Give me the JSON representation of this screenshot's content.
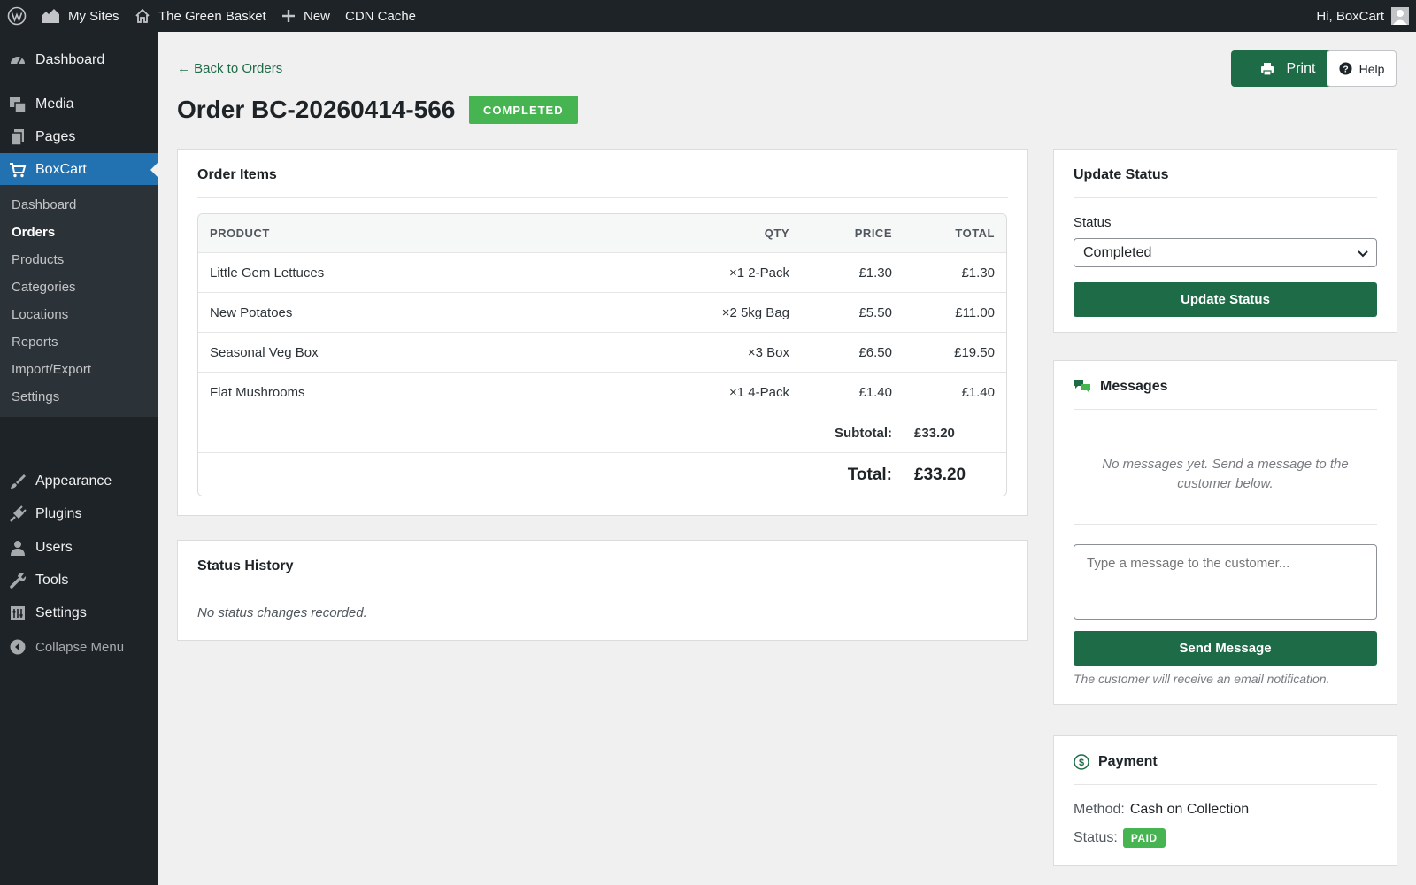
{
  "adminbar": {
    "my_sites": "My Sites",
    "site_name": "The Green Basket",
    "new_label": "New",
    "cdn_cache": "CDN Cache",
    "greeting": "Hi, BoxCart"
  },
  "sidebar": {
    "items": [
      {
        "label": "Dashboard",
        "icon": "dashboard-icon"
      },
      {
        "label": "Media",
        "icon": "media-icon"
      },
      {
        "label": "Pages",
        "icon": "pages-icon"
      },
      {
        "label": "BoxCart",
        "icon": "cart-icon",
        "current": true
      },
      {
        "label": "Appearance",
        "icon": "brush-icon"
      },
      {
        "label": "Plugins",
        "icon": "plugin-icon"
      },
      {
        "label": "Users",
        "icon": "user-icon"
      },
      {
        "label": "Tools",
        "icon": "wrench-icon"
      },
      {
        "label": "Settings",
        "icon": "settings-icon"
      },
      {
        "label": "Collapse Menu",
        "icon": "collapse-icon"
      }
    ],
    "submenu": [
      "Dashboard",
      "Orders",
      "Products",
      "Categories",
      "Locations",
      "Reports",
      "Import/Export",
      "Settings"
    ],
    "submenu_current": "Orders"
  },
  "header": {
    "back_link": "← Back to Orders",
    "title": "Order BC-20260414-566",
    "status_badge": "COMPLETED",
    "print_label": "Print",
    "help_label": "Help"
  },
  "order_items": {
    "title": "Order Items",
    "columns": {
      "product": "PRODUCT",
      "qty": "QTY",
      "price": "PRICE",
      "total": "TOTAL"
    },
    "rows": [
      {
        "product": "Little Gem Lettuces",
        "qty": "×1 2-Pack",
        "price": "£1.30",
        "total": "£1.30"
      },
      {
        "product": "New Potatoes",
        "qty": "×2 5kg Bag",
        "price": "£5.50",
        "total": "£11.00"
      },
      {
        "product": "Seasonal Veg Box",
        "qty": "×3 Box",
        "price": "£6.50",
        "total": "£19.50"
      },
      {
        "product": "Flat Mushrooms",
        "qty": "×1 4-Pack",
        "price": "£1.40",
        "total": "£1.40"
      }
    ],
    "subtotal_label": "Subtotal:",
    "subtotal_value": "£33.20",
    "total_label": "Total:",
    "total_value": "£33.20"
  },
  "status_history": {
    "title": "Status History",
    "empty": "No status changes recorded."
  },
  "update_status": {
    "title": "Update Status",
    "field_label": "Status",
    "selected": "Completed",
    "button": "Update Status"
  },
  "messages": {
    "title": "Messages",
    "empty": "No messages yet. Send a message to the customer below.",
    "placeholder": "Type a message to the customer...",
    "button": "Send Message",
    "note": "The customer will receive an email notification."
  },
  "payment": {
    "title": "Payment",
    "method_label": "Method:",
    "method_value": "Cash on Collection",
    "status_label": "Status:",
    "status_value": "PAID"
  },
  "colors": {
    "brand_green": "#1e6b48",
    "badge_green": "#46b450",
    "admin_dark": "#1d2327",
    "admin_blue": "#2271b1"
  }
}
